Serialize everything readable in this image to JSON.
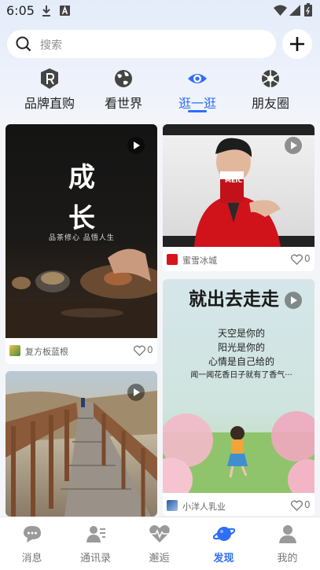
{
  "status_bar": {
    "time": "6:05",
    "icons": [
      "download-icon",
      "a-box-icon",
      "wifi-icon",
      "signal-icon",
      "battery-icon"
    ]
  },
  "search": {
    "placeholder": "搜索"
  },
  "header": {
    "add_icon": "plus-icon"
  },
  "category_tabs": [
    {
      "label": "品牌直购",
      "icon": "brand-r-icon",
      "active": false
    },
    {
      "label": "看世界",
      "icon": "globe-icon",
      "active": false
    },
    {
      "label": "逛一逛",
      "icon": "eye-icon",
      "active": true
    },
    {
      "label": "朋友圈",
      "icon": "aperture-icon",
      "active": false
    }
  ],
  "feed": [
    {
      "image_text_1": "成",
      "image_text_2": "长",
      "image_caption": "品茶修心 品悟人生",
      "author": "复方板蓝根",
      "likes": "0",
      "video": true
    },
    {
      "image_label": "MEIC",
      "author": "蜜雪冰城",
      "likes": "0",
      "video": true
    },
    {
      "image_text": "就出去走走",
      "poem": [
        "天空是你的",
        "阳光是你的",
        "心情是自己给的",
        "闻一闻花香日子就有了香气···"
      ],
      "author": "小洋人乳业",
      "likes": "0",
      "video": true
    },
    {
      "author": "",
      "likes": "",
      "video": true
    }
  ],
  "bottom_nav": [
    {
      "label": "消息",
      "icon": "chat-icon",
      "active": false
    },
    {
      "label": "通讯录",
      "icon": "contacts-icon",
      "active": false
    },
    {
      "label": "邂逅",
      "icon": "heart-pulse-icon",
      "active": false
    },
    {
      "label": "发现",
      "icon": "planet-icon",
      "active": true
    },
    {
      "label": "我的",
      "icon": "person-icon",
      "active": false
    }
  ],
  "colors": {
    "accent": "#2f6ef7",
    "background": "#f3f5f9"
  }
}
